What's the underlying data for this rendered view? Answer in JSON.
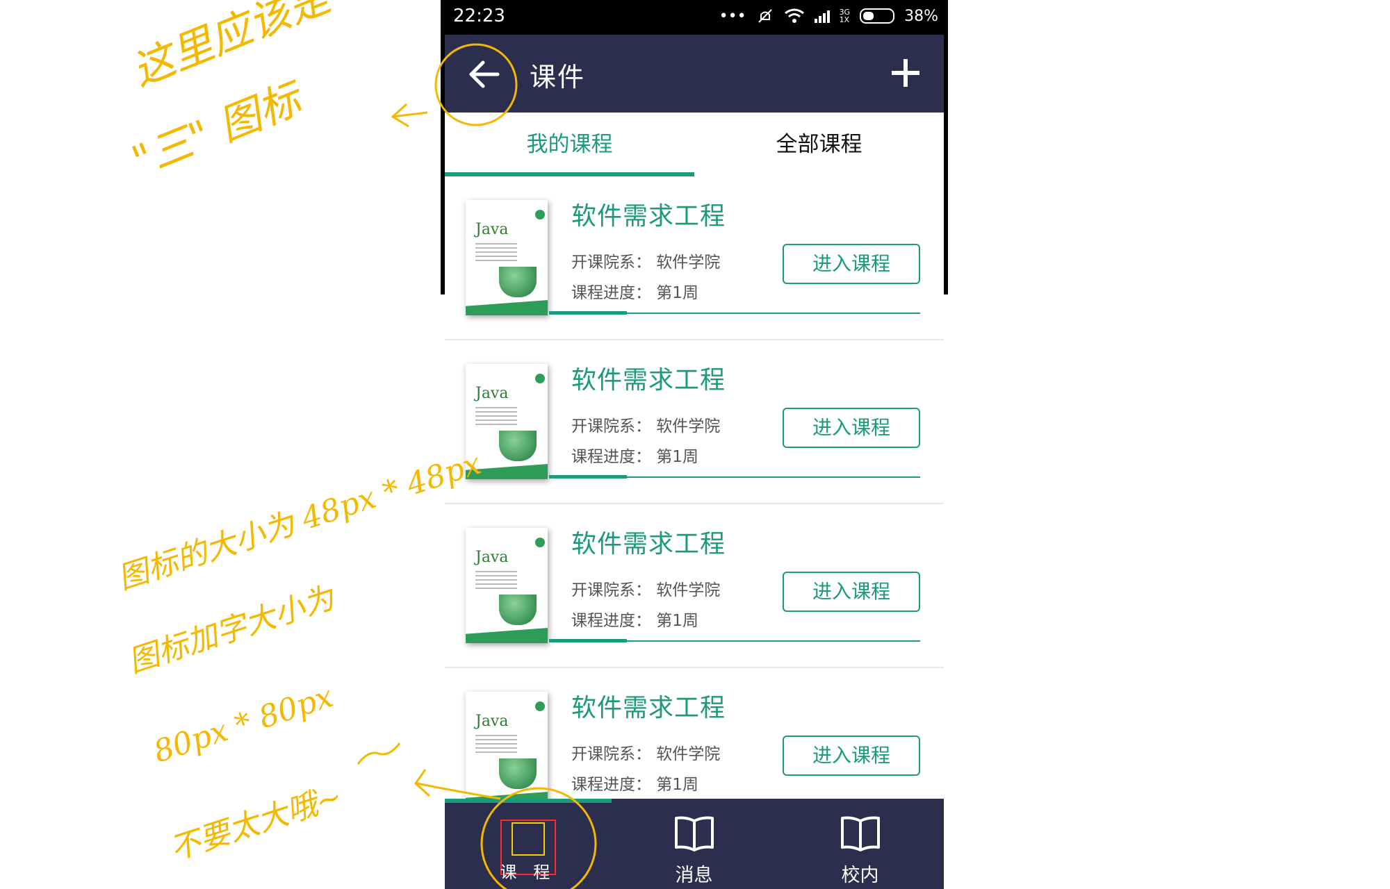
{
  "status_bar": {
    "time": "22:23",
    "network": "3G",
    "signal_sub": "1X",
    "battery": "38%"
  },
  "header": {
    "title": "课件",
    "back_icon": "arrow-left-icon",
    "add_icon": "plus-icon"
  },
  "tabs": [
    {
      "label": "我的课程",
      "active": true
    },
    {
      "label": "全部课程",
      "active": false
    }
  ],
  "courses": [
    {
      "name": "软件需求工程",
      "dept": "开课院系：  软件学院",
      "progress": "课程进度：  第1周",
      "button": "进入课程",
      "book_title": "Java",
      "progress_fraction": 0.21
    },
    {
      "name": "软件需求工程",
      "dept": "开课院系：  软件学院",
      "progress": "课程进度：  第1周",
      "button": "进入课程",
      "book_title": "Java",
      "progress_fraction": 0.21
    },
    {
      "name": "软件需求工程",
      "dept": "开课院系：  软件学院",
      "progress": "课程进度：  第1周",
      "button": "进入课程",
      "book_title": "Java",
      "progress_fraction": 0.21
    },
    {
      "name": "软件需求工程",
      "dept": "开课院系：  软件学院",
      "progress": "课程进度：  第1周",
      "button": "进入课程",
      "book_title": "Java",
      "progress_fraction": 0.21
    }
  ],
  "bottom_nav": [
    {
      "label": "课 程",
      "icon": "placeholder-square-icon",
      "active": true
    },
    {
      "label": "消息",
      "icon": "open-book-icon",
      "active": false
    },
    {
      "label": "校内",
      "icon": "open-book-icon",
      "active": false
    }
  ],
  "annotations": {
    "back_note": "这里应该是",
    "back_note_2": "\"三\" 图标",
    "size_note_1": "图标的大小为 48px * 48px",
    "size_note_2": "图标加字大小为",
    "size_note_3": "80px * 80px",
    "size_note_4": "不要太大哦~"
  },
  "colors": {
    "accent": "#1c9a7c",
    "header_bg": "#2b2f4d",
    "annotation": "#f5b800"
  }
}
